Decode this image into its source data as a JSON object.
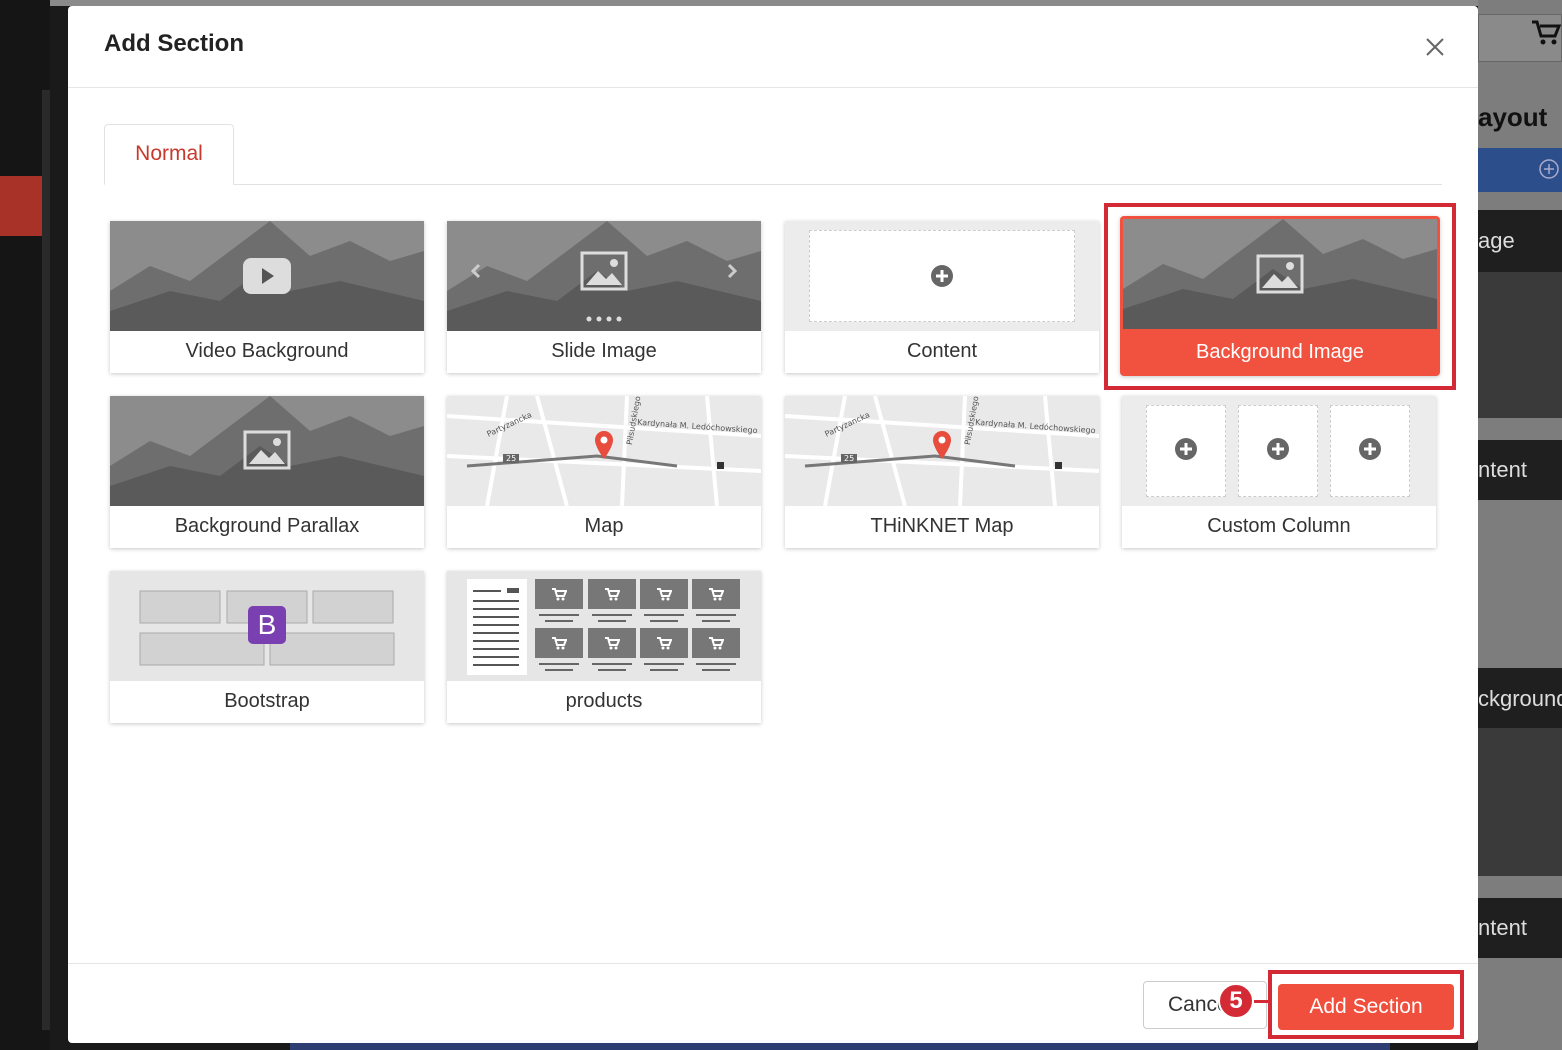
{
  "modal": {
    "title": "Add Section",
    "close_label": "×"
  },
  "tabs": [
    {
      "label": "Normal",
      "active": true
    }
  ],
  "sections": [
    {
      "label": "Video Background",
      "icon": "play-icon",
      "selected": false
    },
    {
      "label": "Slide Image",
      "icon": "image-slider-icon",
      "selected": false
    },
    {
      "label": "Content",
      "icon": "plus-circle-icon",
      "selected": false
    },
    {
      "label": "Background Image",
      "icon": "image-icon",
      "selected": true
    },
    {
      "label": "Background Parallax",
      "icon": "image-icon",
      "selected": false
    },
    {
      "label": "Map",
      "icon": "map-pin-icon",
      "selected": false
    },
    {
      "label": "THiNKNET Map",
      "icon": "map-pin-icon",
      "selected": false
    },
    {
      "label": "Custom Column",
      "icon": "plus-circle-icon",
      "selected": false
    },
    {
      "label": "Bootstrap",
      "icon": "bootstrap-icon",
      "badge_text": "B",
      "selected": false
    },
    {
      "label": "products",
      "icon": "cart-icon",
      "selected": false
    }
  ],
  "map_streets": {
    "street_1": "Partyzancka",
    "street_2": "Kardynała M. Ledóchowskiego",
    "street_3": "Piłsudskiego",
    "street_4": "25"
  },
  "footer": {
    "cancel_label": "Cancel",
    "add_label": "Add Section",
    "step_number": "5"
  },
  "background_page": {
    "right_labels": [
      "ayout",
      "age",
      "ntent",
      "ckground",
      "ntent"
    ]
  },
  "colors": {
    "accent": "#ef4f3c",
    "highlight": "#d42a36",
    "tab_text": "#c8392b"
  }
}
